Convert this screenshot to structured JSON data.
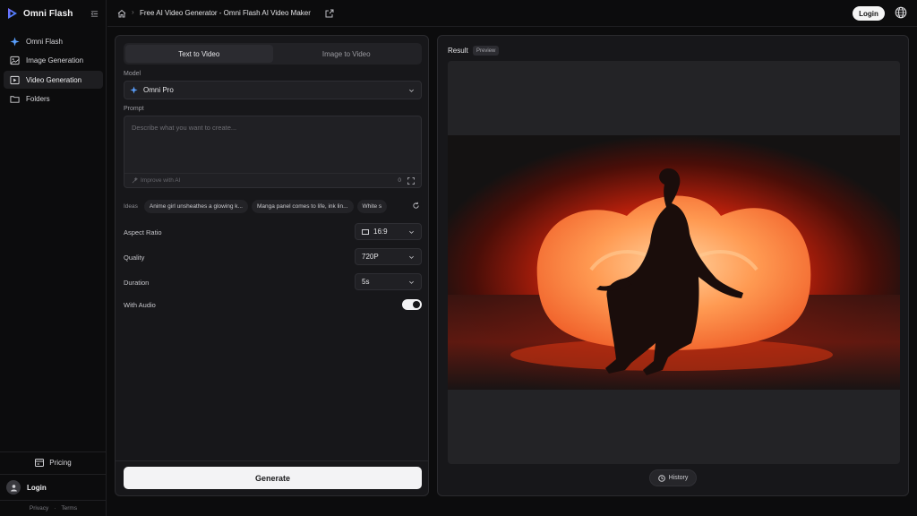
{
  "app": {
    "name": "Omni Flash"
  },
  "header": {
    "page_title": "Free AI Video Generator - Omni Flash AI Video Maker",
    "login_label": "Login"
  },
  "sidebar": {
    "items": [
      {
        "label": "Omni Flash",
        "icon": "sparkle-icon"
      },
      {
        "label": "Image Generation",
        "icon": "image-icon"
      },
      {
        "label": "Video Generation",
        "icon": "video-icon",
        "active": true
      },
      {
        "label": "Folders",
        "icon": "folder-icon"
      }
    ],
    "pricing_label": "Pricing",
    "login_label": "Login",
    "privacy_label": "Privacy",
    "terms_label": "Terms"
  },
  "generator": {
    "tabs": [
      {
        "label": "Text to Video",
        "active": true
      },
      {
        "label": "Image to Video",
        "active": false
      }
    ],
    "model_label": "Model",
    "model_value": "Omni Pro",
    "prompt_label": "Prompt",
    "prompt_placeholder": "Describe what you want to create...",
    "improve_label": "Improve with AI",
    "char_count": "0",
    "ideas_label": "Ideas",
    "ideas": [
      "Anime girl unsheathes a glowing k...",
      "Manga panel comes to life, ink lin...",
      "White s"
    ],
    "aspect_ratio_label": "Aspect Ratio",
    "aspect_ratio_value": "16:9",
    "quality_label": "Quality",
    "quality_value": "720P",
    "duration_label": "Duration",
    "duration_value": "5s",
    "audio_label": "With Audio",
    "audio_enabled": true,
    "generate_label": "Generate"
  },
  "result": {
    "title": "Result",
    "badge": "Preview",
    "history_label": "History"
  },
  "colors": {
    "accent": "#6a5cff",
    "background": "#0c0c0d",
    "panel": "#17171a"
  }
}
